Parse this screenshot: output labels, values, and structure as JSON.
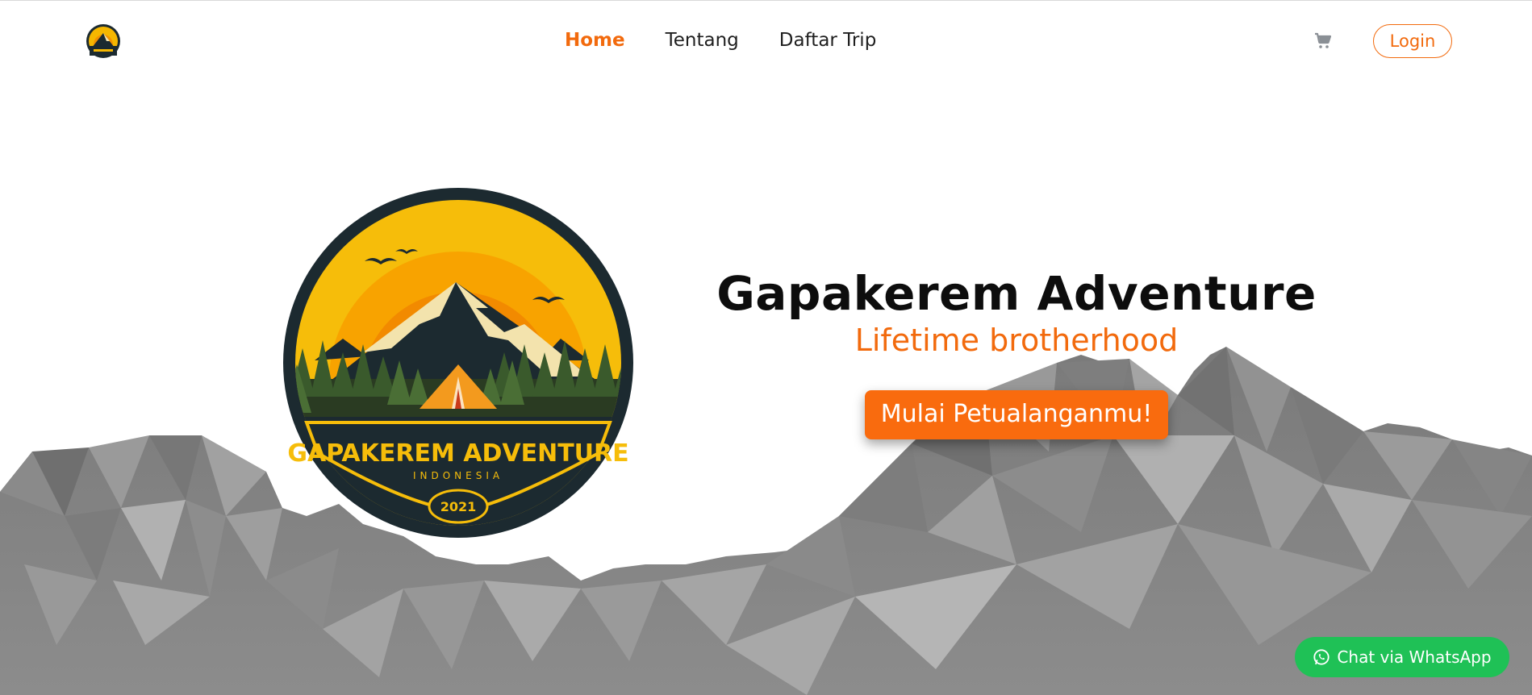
{
  "nav": {
    "links": [
      {
        "label": "Home",
        "active": true
      },
      {
        "label": "Tentang",
        "active": false
      },
      {
        "label": "Daftar Trip",
        "active": false
      }
    ],
    "login_label": "Login",
    "cart_icon": "cart-icon"
  },
  "hero": {
    "title": "Gapakerem Adventure",
    "subtitle": "Lifetime brotherhood",
    "cta_label": "Mulai Petualanganmu!",
    "logo": {
      "name_text": "GAPAKEREM ADVENTURE",
      "country_text": "INDONESIA",
      "year_text": "2021"
    }
  },
  "whatsapp": {
    "label": "Chat via WhatsApp",
    "icon": "whatsapp-icon"
  },
  "colors": {
    "accent": "#f26a0d",
    "cta": "#f96b0e",
    "whatsapp": "#1fc156",
    "logo_dark": "#1c2a30",
    "logo_yellow": "#f5c000"
  }
}
